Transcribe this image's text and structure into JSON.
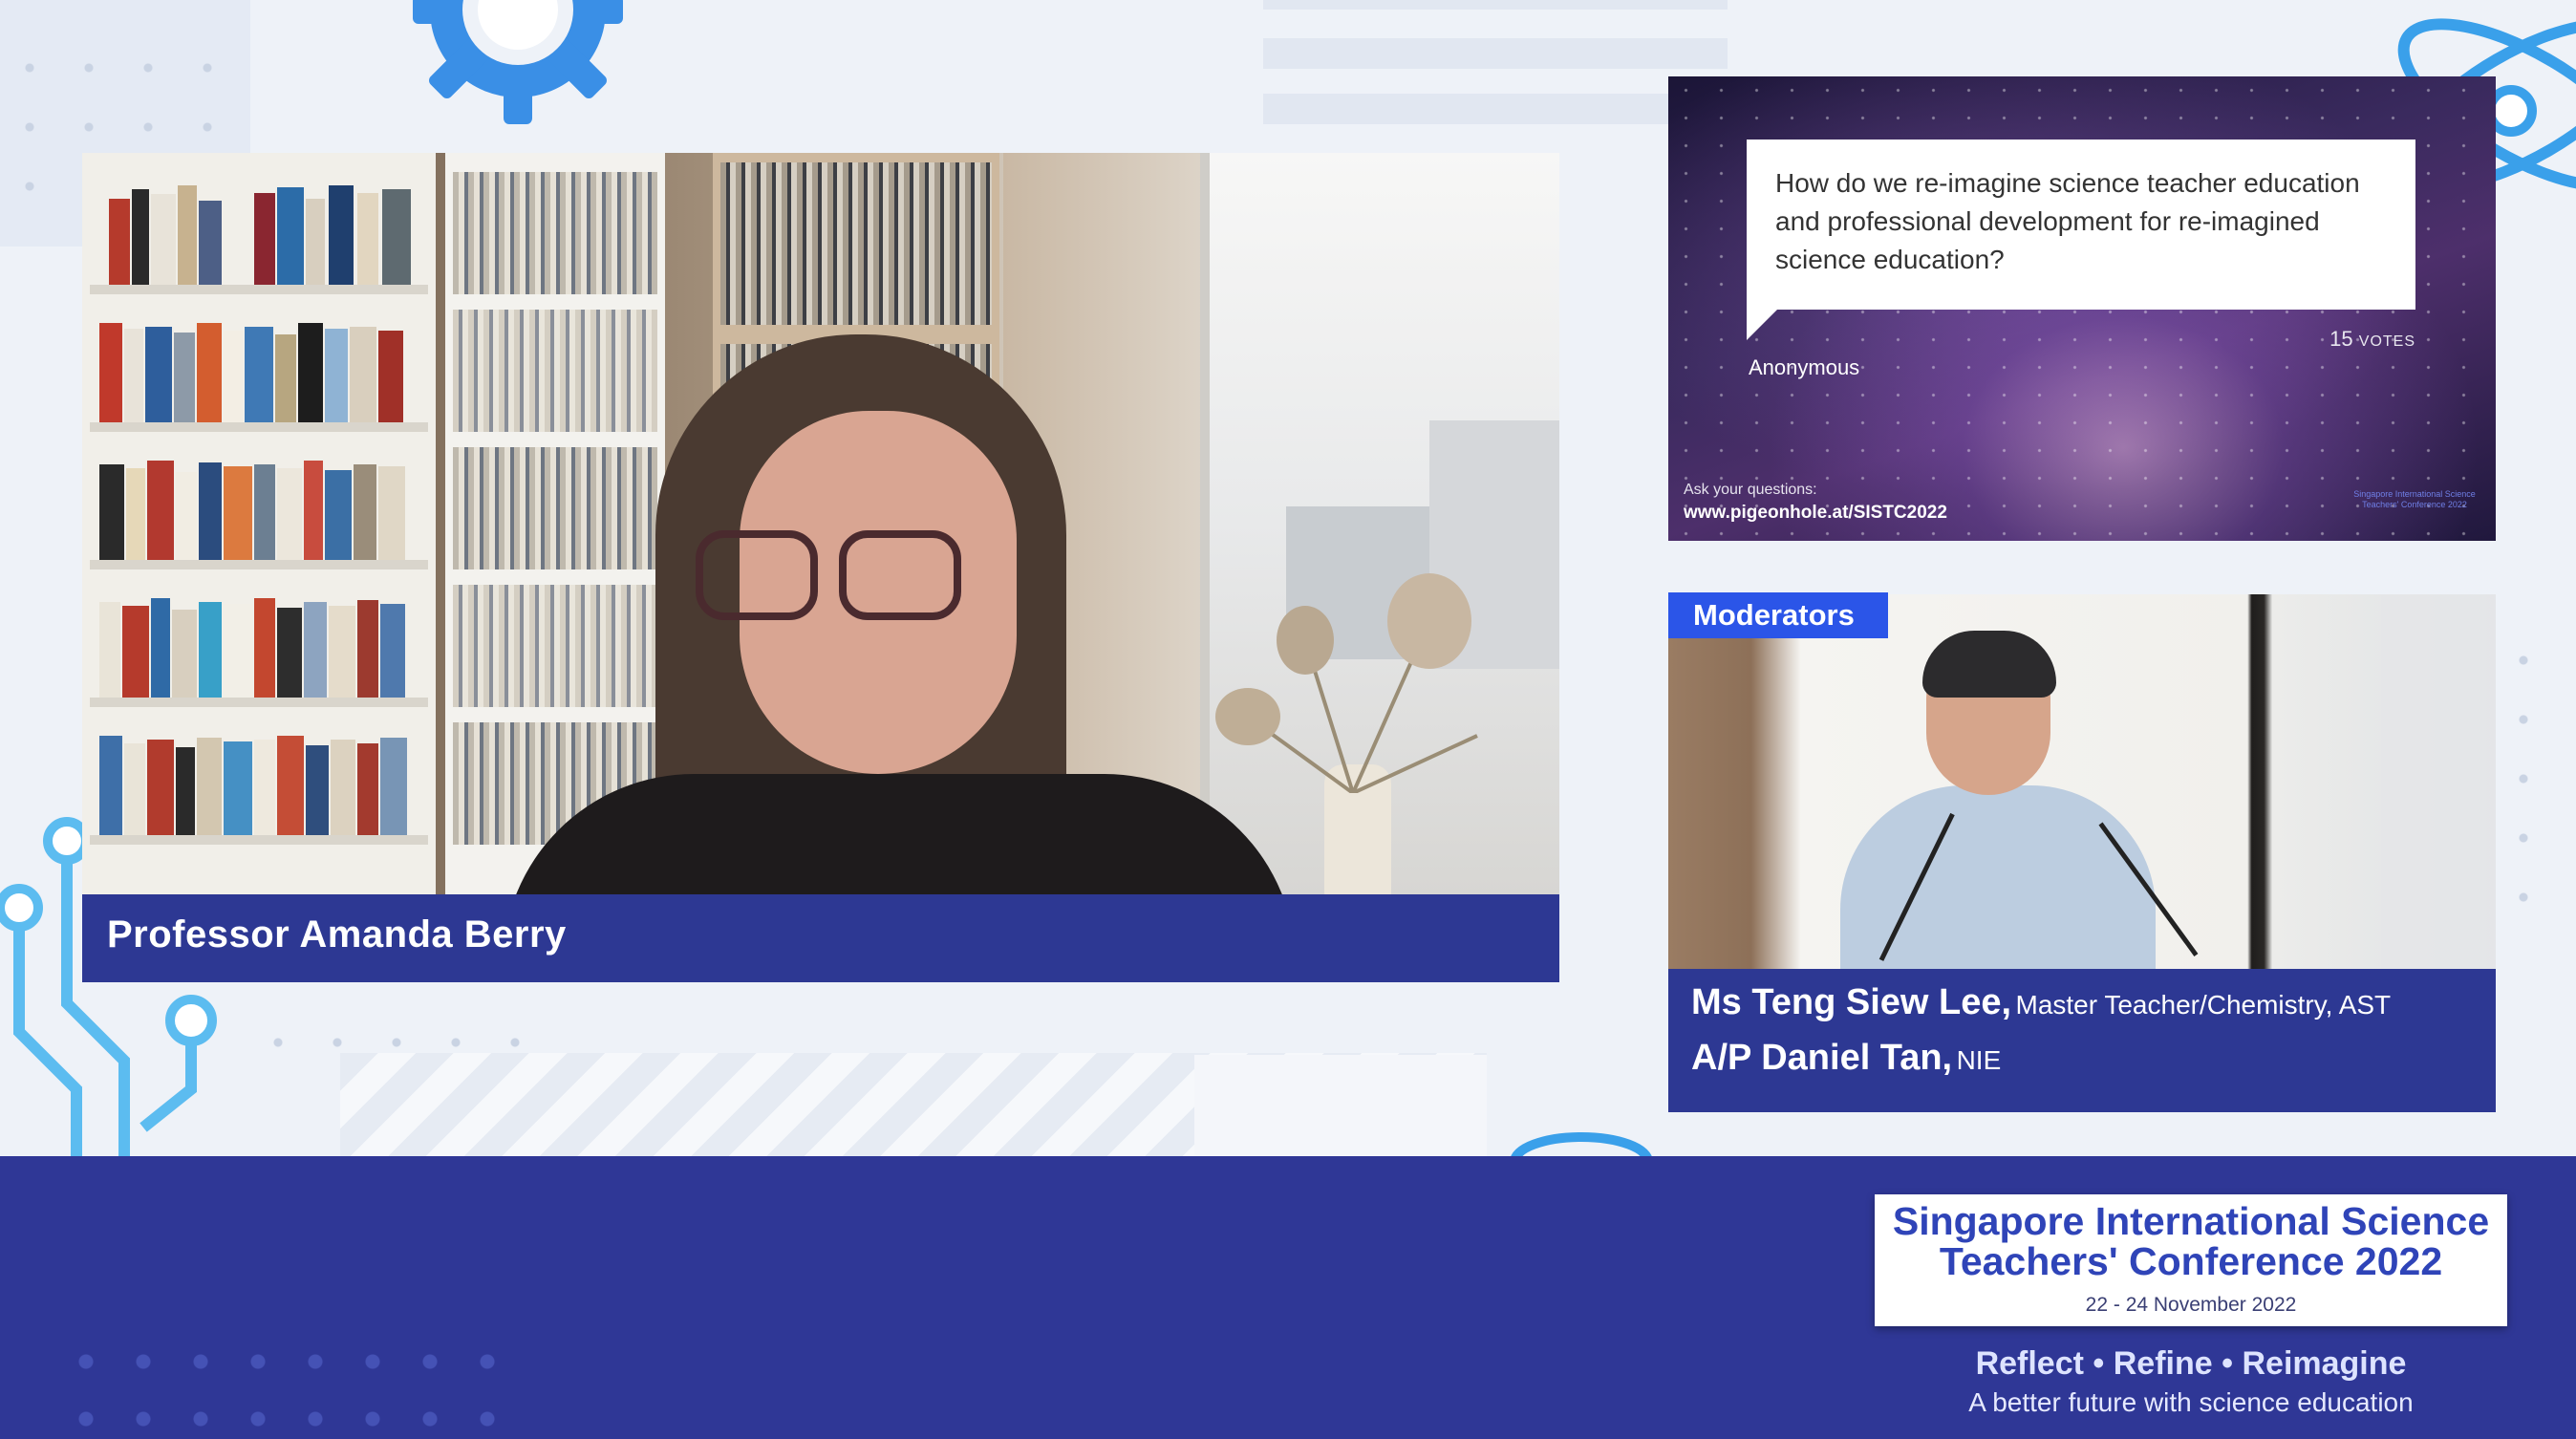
{
  "speaker": {
    "name": "Professor Amanda Berry"
  },
  "slide": {
    "question": "How do we re-imagine science teacher education and professional development for re-imagined science education?",
    "author": "Anonymous",
    "votes_count": "15",
    "votes_label": "VOTES",
    "ask_label": "Ask your questions:",
    "ask_url": "www.pigeonhole.at/SISTC2022",
    "brand_small": "Singapore International Science Teachers' Conference 2022"
  },
  "moderators": {
    "tag": "Moderators",
    "people": [
      {
        "name": "Ms Teng Siew Lee,",
        "role": "Master Teacher/Chemistry, AST"
      },
      {
        "name": "A/P Daniel Tan,",
        "role": "NIE"
      }
    ]
  },
  "conference": {
    "title_line1": "Singapore International Science",
    "title_line2": "Teachers' Conference 2022",
    "dates": "22 - 24 November 2022",
    "tagline": {
      "reflect": "Reflect",
      "refine": "Refine",
      "reimagine": "Reimagine",
      "separator": "•"
    },
    "subtagline": "A better future with science education"
  },
  "colors": {
    "band": "#2f3796",
    "name_bar": "#2d3893",
    "moderator_tag": "#2b55e8",
    "conference_title": "#2f44b8",
    "accent_icon": "#3aa0ea"
  }
}
